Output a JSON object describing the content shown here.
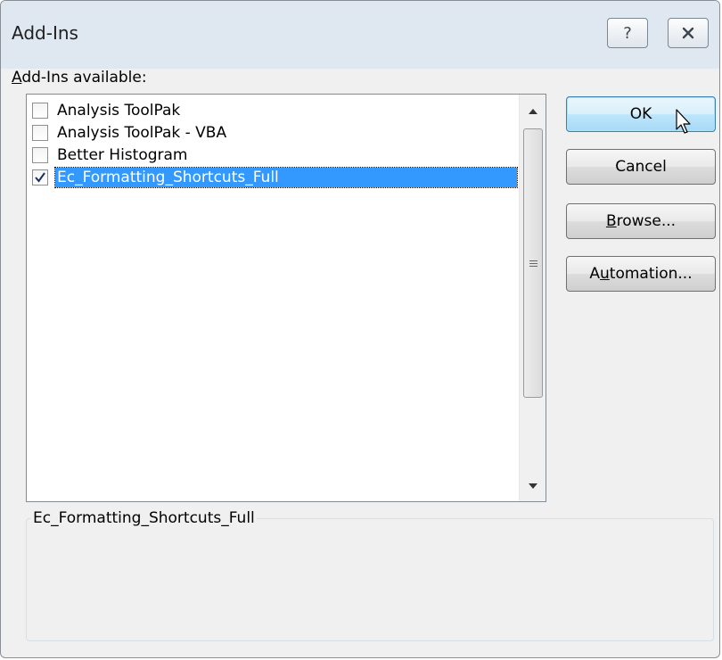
{
  "window": {
    "title": "Add-Ins",
    "help_label": "?",
    "close_label": "×"
  },
  "list": {
    "label_prefix": "A",
    "label_rest": "dd-Ins available:",
    "items": [
      {
        "label": "Analysis ToolPak",
        "checked": false,
        "selected": false
      },
      {
        "label": "Analysis ToolPak - VBA",
        "checked": false,
        "selected": false
      },
      {
        "label": "Better Histogram",
        "checked": false,
        "selected": false
      },
      {
        "label": "Ec_Formatting_Shortcuts_Full",
        "checked": true,
        "selected": true
      }
    ]
  },
  "buttons": {
    "ok": "OK",
    "cancel": "Cancel",
    "browse_mnemonic": "B",
    "browse_rest": "rowse...",
    "automation_pre": "A",
    "automation_mnemonic": "u",
    "automation_rest": "tomation..."
  },
  "description": {
    "title": "Ec_Formatting_Shortcuts_Full",
    "text": ""
  },
  "colors": {
    "selection": "#3399ff",
    "dialog_bg": "#f0f0f0",
    "titlebar_bg": "#dfe8f1"
  }
}
